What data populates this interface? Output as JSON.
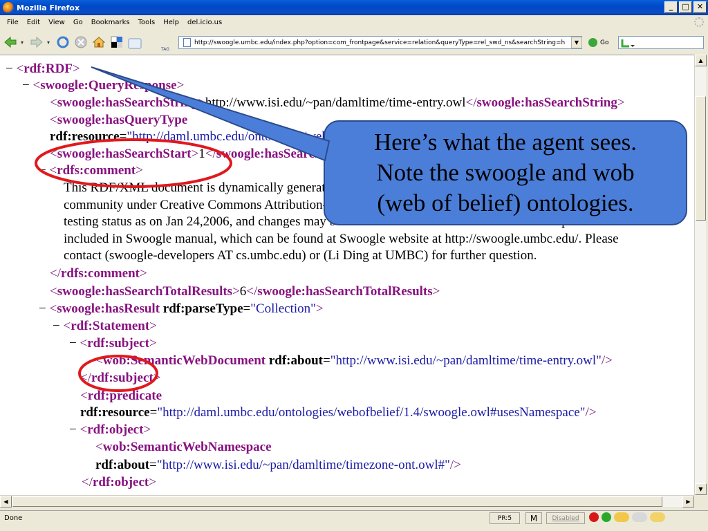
{
  "window": {
    "title": "Mozilla Firefox"
  },
  "menubar": {
    "items": [
      "File",
      "Edit",
      "View",
      "Go",
      "Bookmarks",
      "Tools",
      "Help",
      "del.icio.us"
    ]
  },
  "toolbar": {
    "url": "http://swoogle.umbc.edu/index.php?option=com_frontpage&service=relation&queryType=rel_swd_ns&searchString=h",
    "go_label": "Go",
    "tag_label": "TAG"
  },
  "content": {
    "lines": [
      [
        [
          "minus",
          "− "
        ],
        [
          "br",
          "<"
        ],
        [
          "tag",
          "rdf:RDF"
        ],
        [
          "br",
          ">"
        ]
      ],
      [
        [
          "minus",
          "− "
        ],
        [
          "br",
          "<"
        ],
        [
          "tag",
          "swoogle:QueryResponse"
        ],
        [
          "br",
          ">"
        ]
      ],
      [
        [
          "br",
          "<"
        ],
        [
          "tag",
          "swoogle:hasSearchString"
        ],
        [
          "br",
          ">"
        ],
        [
          "text",
          "http://www.isi.edu/~pan/damltime/time-entry.owl"
        ],
        [
          "br",
          "</"
        ],
        [
          "tag",
          "swoogle:hasSearchString"
        ],
        [
          "br",
          ">"
        ]
      ],
      [
        [
          "br",
          "<"
        ],
        [
          "tag",
          "swoogle:hasQueryType"
        ]
      ],
      [
        [
          "attr",
          "rdf:resource"
        ],
        [
          "text",
          "="
        ],
        [
          "val",
          "\"http://daml.umbc.edu/ontologies/webofbelief/1.4/swoogle.owl#rel_swd_ns\""
        ],
        [
          "br",
          "/>"
        ]
      ],
      [
        [
          "br",
          "<"
        ],
        [
          "tag",
          "swoogle:hasSearchStart"
        ],
        [
          "br",
          ">"
        ],
        [
          "text",
          "1"
        ],
        [
          "br",
          "</"
        ],
        [
          "tag",
          "swoogle:hasSearchStart"
        ],
        [
          "br",
          ">"
        ]
      ],
      [
        [
          "minus",
          "− "
        ],
        [
          "br",
          "<"
        ],
        [
          "tag",
          "rdfs:comment"
        ],
        [
          "br",
          ">"
        ]
      ],
      [
        [
          "text",
          "This RDF/XML document is dynamically generated by Swoogle and released to the Semantic Web research"
        ]
      ],
      [
        [
          "text",
          "community under Creative Commons Attribution-NonCommercial-ShareAlike 2.0 License. Swoogle is under"
        ]
      ],
      [
        [
          "text",
          "testing status as on Jan 24,2006, and changes may be made without notification. Service description is"
        ]
      ],
      [
        [
          "text",
          "included in Swoogle manual, which can be found at Swoogle website at http://swoogle.umbc.edu/. Please"
        ]
      ],
      [
        [
          "text",
          "contact (swoogle-developers AT cs.umbc.edu) or (Li Ding at UMBC) for further question."
        ]
      ],
      [
        [
          "br",
          "</"
        ],
        [
          "tag",
          "rdfs:comment"
        ],
        [
          "br",
          ">"
        ]
      ],
      [
        [
          "br",
          "<"
        ],
        [
          "tag",
          "swoogle:hasSearchTotalResults"
        ],
        [
          "br",
          ">"
        ],
        [
          "text",
          "6"
        ],
        [
          "br",
          "</"
        ],
        [
          "tag",
          "swoogle:hasSearchTotalResults"
        ],
        [
          "br",
          ">"
        ]
      ],
      [
        [
          "minus",
          "− "
        ],
        [
          "br",
          "<"
        ],
        [
          "tag",
          "swoogle:hasResult"
        ],
        [
          "text",
          " "
        ],
        [
          "attr",
          "rdf:parseType"
        ],
        [
          "text",
          "="
        ],
        [
          "val",
          "\"Collection\""
        ],
        [
          "br",
          ">"
        ]
      ],
      [
        [
          "minus",
          "− "
        ],
        [
          "br",
          "<"
        ],
        [
          "tag",
          "rdf:Statement"
        ],
        [
          "br",
          ">"
        ]
      ],
      [
        [
          "minus",
          "− "
        ],
        [
          "br",
          "<"
        ],
        [
          "tag",
          "rdf:subject"
        ],
        [
          "br",
          ">"
        ]
      ],
      [
        [
          "br",
          "<"
        ],
        [
          "tag",
          "wob:SemanticWebDocument"
        ],
        [
          "text",
          " "
        ],
        [
          "attr",
          "rdf:about"
        ],
        [
          "text",
          "="
        ],
        [
          "val",
          "\"http://www.isi.edu/~pan/damltime/time-entry.owl\""
        ],
        [
          "br",
          "/>"
        ]
      ],
      [
        [
          "br",
          "</"
        ],
        [
          "tag",
          "rdf:subject"
        ],
        [
          "br",
          ">"
        ]
      ],
      [
        [
          "br",
          "<"
        ],
        [
          "tag",
          "rdf:predicate"
        ]
      ],
      [
        [
          "attr",
          "rdf:resource"
        ],
        [
          "text",
          "="
        ],
        [
          "val",
          "\"http://daml.umbc.edu/ontologies/webofbelief/1.4/swoogle.owl#usesNamespace\""
        ],
        [
          "br",
          "/>"
        ]
      ],
      [
        [
          "minus",
          "− "
        ],
        [
          "br",
          "<"
        ],
        [
          "tag",
          "rdf:object"
        ],
        [
          "br",
          ">"
        ]
      ],
      [
        [
          "br",
          "<"
        ],
        [
          "tag",
          "wob:SemanticWebNamespace"
        ]
      ],
      [
        [
          "attr",
          "rdf:about"
        ],
        [
          "text",
          "="
        ],
        [
          "val",
          "\"http://www.isi.edu/~pan/damltime/timezone-ont.owl#\""
        ],
        [
          "br",
          "/>"
        ]
      ],
      [
        [
          "br",
          "</"
        ],
        [
          "tag",
          "rdf:object"
        ],
        [
          "br",
          ">"
        ]
      ]
    ]
  },
  "callout": {
    "lines": [
      "Here’s what the agent sees.",
      "Note the swoogle and wob",
      "(web of belief) ontologies."
    ],
    "fill": "#4b7ed8"
  },
  "annotation_color": "#e0191e",
  "statusbar": {
    "status": "Done",
    "pagerank": "PR:5",
    "mail": "M",
    "disabled": "Disabled"
  }
}
